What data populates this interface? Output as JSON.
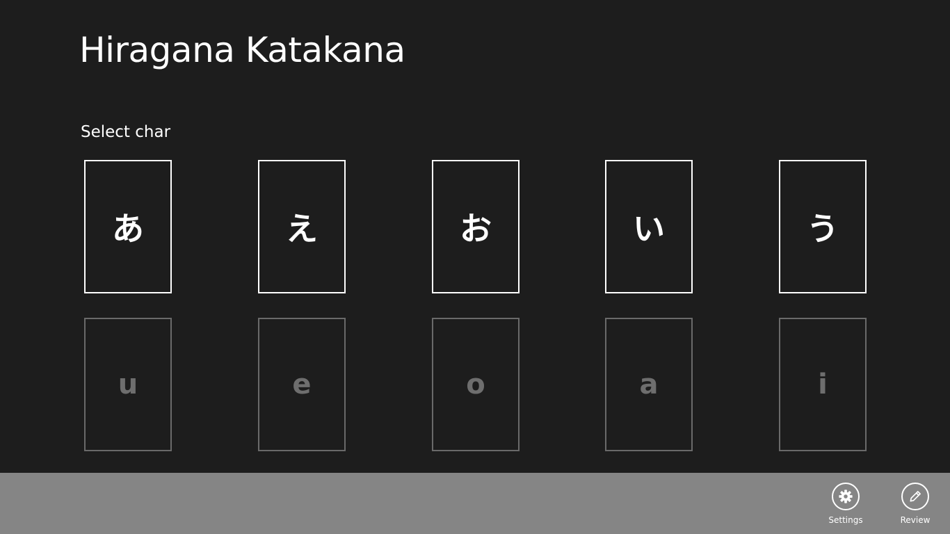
{
  "header": {
    "title": "Hiragana Katakana"
  },
  "main": {
    "section_title": "Select char",
    "characters": [
      "あ",
      "え",
      "お",
      "い",
      "う"
    ],
    "romaji": [
      "u",
      "e",
      "o",
      "a",
      "i"
    ]
  },
  "app_bar": {
    "settings_label": "Settings",
    "settings_icon": "gear-icon",
    "review_label": "Review",
    "review_icon": "pencil-icon"
  },
  "colors": {
    "background": "#1d1d1d",
    "app_bar": "#858585",
    "tile_active_border": "#ffffff",
    "tile_inactive_border": "#6a6a6a",
    "tile_inactive_text": "#6e6e6e"
  }
}
